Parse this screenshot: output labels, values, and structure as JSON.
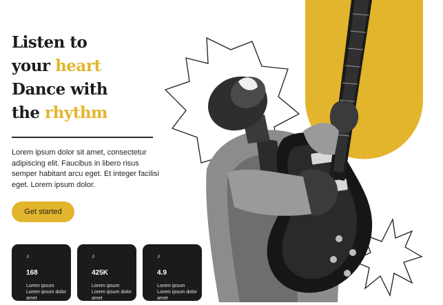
{
  "hero": {
    "line1": "Listen to",
    "line2_prefix": "your ",
    "line2_accent": "heart",
    "line3": "Dance with",
    "line4_prefix": "the ",
    "line4_accent": "rhythm",
    "description": "Lorem ipsum dolor sit amet, consectetur adipiscing elit. Faucibus in libero risus semper habitant arcu eget. Et integer facilisi eget. Lorem ipsum dolor.",
    "cta_label": "Get started"
  },
  "stats": [
    {
      "icon": "music-note-icon",
      "value": "168",
      "label": "Lorem ipsum Lorem ipsum dolor amet"
    },
    {
      "icon": "music-note-icon",
      "value": "425K",
      "label": "Lorem ipsum Lorem ipsum dolor amet"
    },
    {
      "icon": "music-note-icon",
      "value": "4.9",
      "label": "Lorem ipsum Lorem ipsum dolor amet"
    }
  ],
  "colors": {
    "accent": "#e3b52d",
    "dark": "#1b1b1b",
    "text": "#1e1e1e"
  },
  "hero_image": {
    "subject": "guitarist-photo",
    "style": "grayscale"
  }
}
